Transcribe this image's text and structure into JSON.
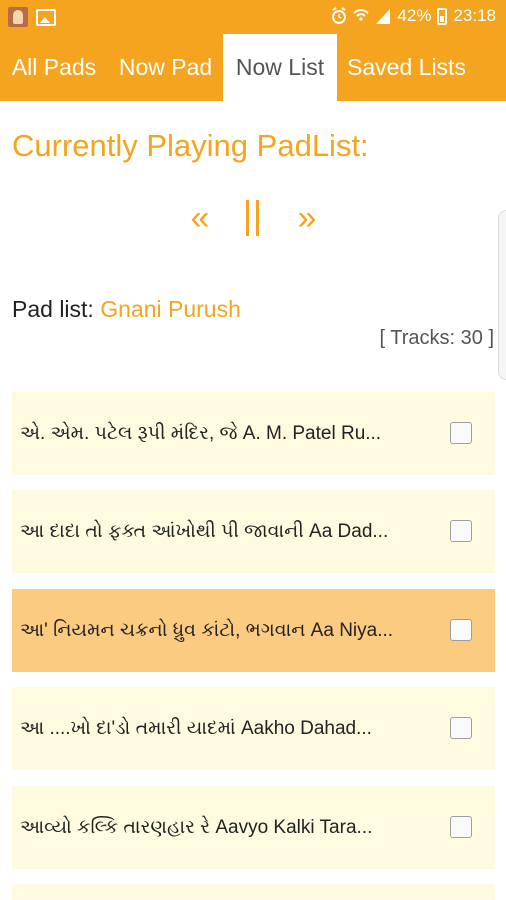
{
  "status_bar": {
    "battery": "42%",
    "time": "23:18"
  },
  "tabs": [
    {
      "label": "All Pads"
    },
    {
      "label": "Now Pad"
    },
    {
      "label": "Now List"
    },
    {
      "label": "Saved Lists"
    }
  ],
  "player": {
    "heading": "Currently Playing PadList:",
    "prev_symbol": "«",
    "next_symbol": "»"
  },
  "padlist": {
    "label": "Pad list:",
    "name": "Gnani Purush",
    "tracks_label": "[ Tracks: 30 ]"
  },
  "tracks": [
    {
      "title": "એ. એમ. પટેલ રૂપી મંદિર, જે A. M. Patel Ru..."
    },
    {
      "title": "આ દાદા તો ફક્ત આંખોથી પી જાવાની Aa Dad..."
    },
    {
      "title": "આ' નિયમન ચક્રનો ધ્રુવ કાંટો, ભગવાન Aa Niya..."
    },
    {
      "title": "આ ....ખો દા'ડો તમારી યાદમાં Aakho Dahad..."
    },
    {
      "title": "આવ્યો કલ્કિ તારણહાર રે Aavyo Kalki Tara..."
    }
  ],
  "colors": {
    "accent": "#f4a41e",
    "row_bg": "#fefbe0",
    "row_active_bg": "#fbcb82"
  }
}
